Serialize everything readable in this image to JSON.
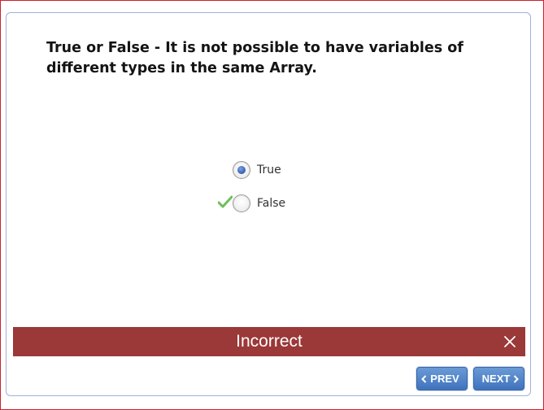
{
  "question": {
    "text": "True or False - It is not possible to have variables of different types in the same Array."
  },
  "options": [
    {
      "label": "True",
      "selected": true
    },
    {
      "label": "False",
      "selected": false,
      "correct_marker": "checkmark-icon"
    }
  ],
  "feedback": {
    "text": "Incorrect",
    "color": "#9b3838"
  },
  "nav": {
    "prev_label": "PREV",
    "next_label": "NEXT"
  },
  "colors": {
    "accent": "#4a7cc4",
    "frame_border": "#c8242c"
  }
}
